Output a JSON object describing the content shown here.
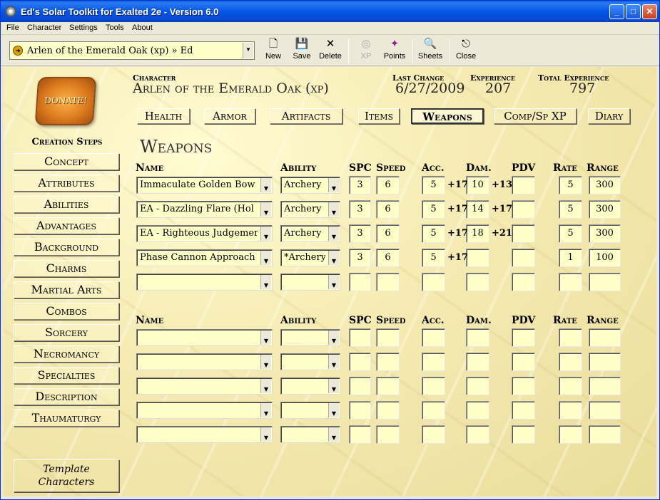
{
  "window": {
    "title": "Ed's Solar Toolkit for Exalted 2e - Version 6.0"
  },
  "menu": [
    "File",
    "Character",
    "Settings",
    "Tools",
    "About"
  ],
  "toolbar": {
    "character_select": "Arlen of the Emerald Oak (xp) » Ed",
    "buttons": [
      {
        "label": "New",
        "icon": "new-document-icon"
      },
      {
        "label": "Save",
        "icon": "floppy-disk-icon"
      },
      {
        "label": "Delete",
        "icon": "delete-x-icon"
      },
      {
        "label": "XP",
        "icon": "xp-disc-icon"
      },
      {
        "label": "Points",
        "icon": "points-figure-icon"
      },
      {
        "label": "Sheets",
        "icon": "sheets-magnifier-icon"
      },
      {
        "label": "Close",
        "icon": "close-door-icon"
      }
    ]
  },
  "donate": "DONATE!",
  "creation_steps": {
    "title": "Creation Steps",
    "items": [
      "Concept",
      "Attributes",
      "Abilities",
      "Advantages",
      "Background",
      "Charms",
      "Martial Arts",
      "Combos",
      "Sorcery",
      "Necromancy",
      "Specialties",
      "Description",
      "Thaumaturgy"
    ],
    "template": [
      "Template",
      "Characters"
    ]
  },
  "header": {
    "character_label": "Character",
    "character_name": "Arlen of the Emerald Oak (xp)",
    "last_change_label": "Last Change",
    "last_change": "6/27/2009",
    "experience_label": "Experience",
    "experience": "207",
    "total_experience_label": "Total Experience",
    "total_experience": "797"
  },
  "tabs": [
    {
      "label": "Health",
      "active": false
    },
    {
      "label": "Armor",
      "active": false
    },
    {
      "label": "Artifacts",
      "active": false
    },
    {
      "label": "Items",
      "active": false
    },
    {
      "label": "Weapons",
      "active": true
    },
    {
      "label": "Comp/Sp XP",
      "active": false
    },
    {
      "label": "Diary",
      "active": false
    }
  ],
  "section_title": "Weapons",
  "columns": {
    "name": "Name",
    "ability": "Ability",
    "spc": "SPC",
    "speed": "Speed",
    "acc": "Acc.",
    "dam": "Dam.",
    "pdv": "PDV",
    "rate": "Rate",
    "range": "Range"
  },
  "weapons_top": [
    {
      "name": "Immaculate Golden Bow",
      "ability": "Archery",
      "spc": "3",
      "speed": "6",
      "acc": "5",
      "acc_bonus": "+17",
      "dam": "10",
      "dam_bonus": "+13",
      "pdv": "",
      "rate": "5",
      "range": "300"
    },
    {
      "name": "EA - Dazzling Flare (Hol",
      "ability": "Archery",
      "spc": "3",
      "speed": "6",
      "acc": "5",
      "acc_bonus": "+17",
      "dam": "14",
      "dam_bonus": "+17",
      "pdv": "",
      "rate": "5",
      "range": "300"
    },
    {
      "name": "EA - Righteous Judgemer",
      "ability": "Archery",
      "spc": "3",
      "speed": "6",
      "acc": "5",
      "acc_bonus": "+17",
      "dam": "18",
      "dam_bonus": "+21",
      "pdv": "",
      "rate": "5",
      "range": "300"
    },
    {
      "name": "Phase Cannon Approach",
      "ability": "*Archery",
      "spc": "3",
      "speed": "6",
      "acc": "5",
      "acc_bonus": "+17",
      "dam": "",
      "dam_bonus": "",
      "pdv": "",
      "rate": "1",
      "range": "100"
    },
    {
      "name": "",
      "ability": "",
      "spc": "",
      "speed": "",
      "acc": "",
      "acc_bonus": "",
      "dam": "",
      "dam_bonus": "",
      "pdv": "",
      "rate": "",
      "range": ""
    }
  ],
  "weapons_bottom": [
    {
      "name": "",
      "ability": "",
      "spc": "",
      "speed": "",
      "acc": "",
      "dam": "",
      "pdv": "",
      "rate": "",
      "range": ""
    },
    {
      "name": "",
      "ability": "",
      "spc": "",
      "speed": "",
      "acc": "",
      "dam": "",
      "pdv": "",
      "rate": "",
      "range": ""
    },
    {
      "name": "",
      "ability": "",
      "spc": "",
      "speed": "",
      "acc": "",
      "dam": "",
      "pdv": "",
      "rate": "",
      "range": ""
    },
    {
      "name": "",
      "ability": "",
      "spc": "",
      "speed": "",
      "acc": "",
      "dam": "",
      "pdv": "",
      "rate": "",
      "range": ""
    },
    {
      "name": "",
      "ability": "",
      "spc": "",
      "speed": "",
      "acc": "",
      "dam": "",
      "pdv": "",
      "rate": "",
      "range": ""
    }
  ]
}
